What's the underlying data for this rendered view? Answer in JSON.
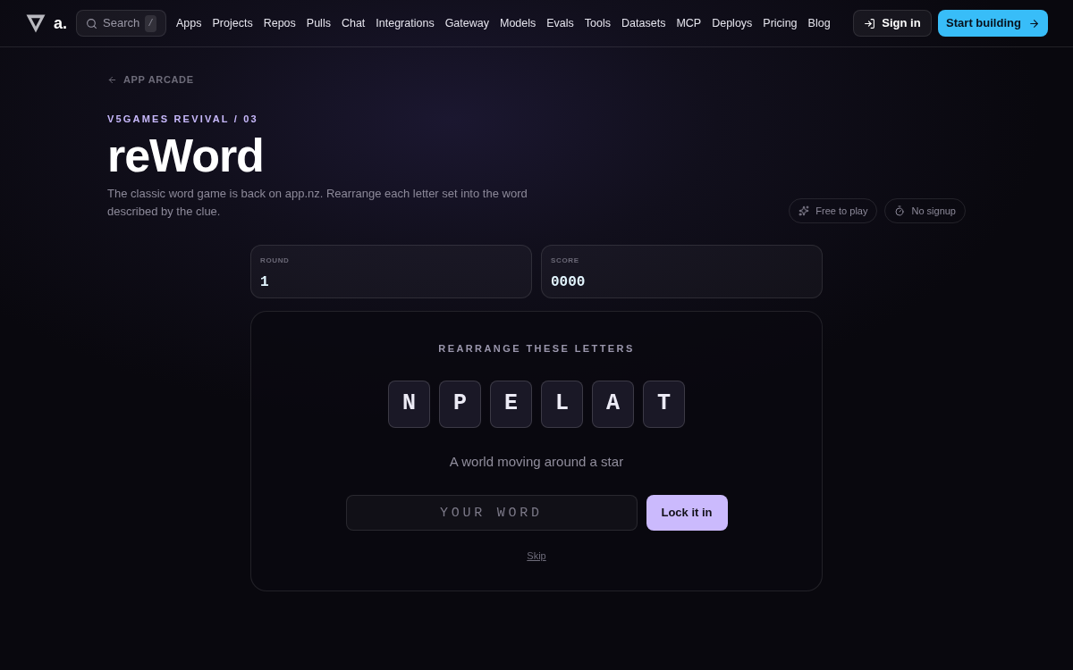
{
  "nav": {
    "brand": "a.",
    "search": {
      "placeholder": "Search",
      "shortcut": "/"
    },
    "links": [
      "Apps",
      "Projects",
      "Repos",
      "Pulls",
      "Chat",
      "Integrations",
      "Gateway",
      "Models",
      "Evals",
      "Tools",
      "Datasets",
      "MCP",
      "Deploys",
      "Pricing",
      "Blog"
    ],
    "sign_in": "Sign in",
    "cta": "Start building"
  },
  "breadcrumb": "APP ARCADE",
  "eyebrow": "V5GAMES REVIVAL / 03",
  "title": "reWord",
  "description": "The classic word game is back on app.nz. Rearrange each letter set into the word described by the clue.",
  "badges": [
    "Free to play",
    "No signup"
  ],
  "stats": [
    {
      "label": "ROUND",
      "value": "1"
    },
    {
      "label": "SCORE",
      "value": "0000"
    }
  ],
  "game": {
    "heading": "REARRANGE THESE LETTERS",
    "letters": [
      "N",
      "P",
      "E",
      "L",
      "A",
      "T"
    ],
    "clue": "A world moving around a star",
    "input": {
      "placeholder": "YOUR WORD"
    },
    "submit": "Lock it in",
    "skip": "Skip"
  }
}
